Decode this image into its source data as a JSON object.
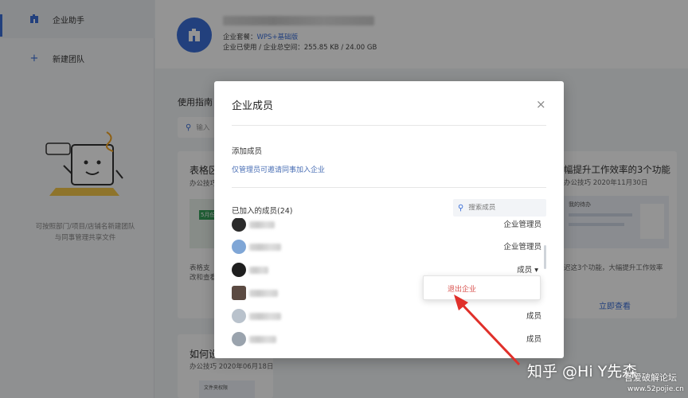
{
  "sidebar": {
    "items": [
      {
        "label": "企业助手",
        "icon": "building-icon"
      },
      {
        "label": "新建团队",
        "icon": "plus-icon"
      }
    ],
    "tip": "可按照部门/项目/店铺名新建团队\n与同事管理共享文件"
  },
  "org": {
    "plan_prefix": "企业套餐：",
    "plan_value": "WPS+基础版",
    "storage_text": "企业已使用 / 企业总空间：255.85 KB / 24.00 GB"
  },
  "background": {
    "guide_title": "使用指南",
    "search_placeholder": "输入",
    "card1_title": "表格区",
    "card1_sub": "办公技巧",
    "card1_desc1": "表格支",
    "card1_desc2": "改和查看",
    "card1_chip": "5月份",
    "card2_title": "幅提升工作效率的3个功能",
    "card2_date": "办公技巧  2020年11月30日",
    "card2_desc": "迟这3个功能，大幅提升工作效率",
    "card2_link": "立即查看",
    "card2_thumb_text": "我的待办",
    "card3_title": "如何设",
    "card3_date": "办公技巧  2020年06月18日",
    "card3_thumb_text": "文件夹权限"
  },
  "modal": {
    "title": "企业成员",
    "add_label": "添加成员",
    "add_hint": "仅管理员可邀请同事加入企业",
    "joined_label": "已加入的成员(24)",
    "search_placeholder": "搜索成员",
    "members": [
      {
        "role": "企业管理员",
        "avatar_color": "#2b2b2b"
      },
      {
        "role": "企业管理员",
        "avatar_color": "#7fa6d6"
      },
      {
        "role": "成员 ▾",
        "avatar_color": "#1f1f1f"
      },
      {
        "role": "",
        "avatar_color": "#5b4a42"
      },
      {
        "role": "成员",
        "avatar_color": "#b9c2cc"
      },
      {
        "role": "成员",
        "avatar_color": "#9aa3ad"
      }
    ],
    "dropdown_option": "退出企业"
  },
  "watermark": {
    "line1": "知乎 @Hi Y先森",
    "line2": "吾爱破解论坛",
    "line3": "www.52pojie.cn"
  },
  "colors": {
    "accent": "#3b6fd8",
    "danger": "#d9534f",
    "annotation": "#e0302a"
  }
}
